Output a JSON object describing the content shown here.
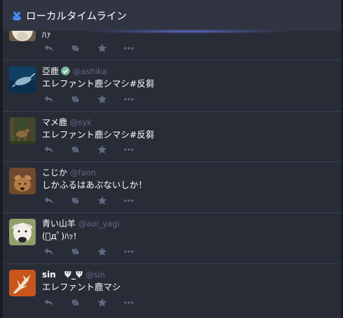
{
  "column": {
    "title": "ローカルタイムライン",
    "icon": "users-icon"
  },
  "statuses": [
    {
      "display_name": "",
      "acct": "",
      "content": "ﾊｧ",
      "avatar": "alpaca-avatar",
      "verified": false
    },
    {
      "display_name": "亞鹿",
      "acct": "@ashika",
      "content": "エレファント鹿シマシ#反芻",
      "avatar": "narwhal-avatar",
      "verified": true
    },
    {
      "display_name": "マメ鹿",
      "acct": "@syk",
      "content": "エレファント鹿シマシ#反芻",
      "avatar": "deer-forest-avatar",
      "verified": false
    },
    {
      "display_name": "こじか",
      "acct": "@faon",
      "content": "しかふるはあぶないしか！",
      "avatar": "fawn-avatar",
      "verified": false
    },
    {
      "display_name": "青い山羊",
      "acct": "@aoi_yagi",
      "content": "(ﾟдﾟ)ﾊｯ!",
      "avatar": "goat-avatar",
      "verified": false
    },
    {
      "display_name": "sin　Ψ_Ψ",
      "acct": "@sin",
      "content": "エレファント鹿マシ",
      "avatar": "antler-avatar",
      "verified": false
    }
  ],
  "colors": {
    "background": "#191b22",
    "column": "#282c37",
    "header": "#313543",
    "muted": "#606984",
    "verified": "#79bd9a"
  }
}
